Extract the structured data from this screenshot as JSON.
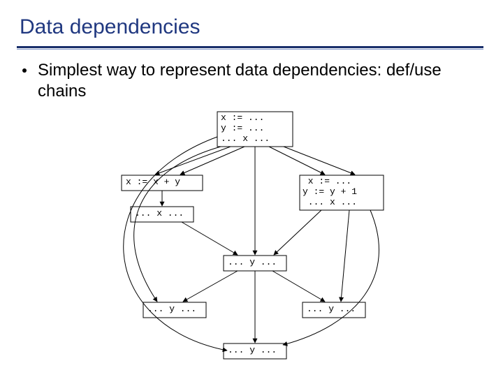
{
  "title": "Data dependencies",
  "bullet": "Simplest way to represent data dependencies: def/use chains",
  "nodes": {
    "top": "x := ...\ny := ...\n... x ...",
    "midL_a": "x := x + y",
    "midL_b": "... x ...",
    "midR": " x := ...\ny := y + 1\n ... x ...",
    "c": "... y ...",
    "botL": "... y ...",
    "botR": "... y ...",
    "bot": "... y ..."
  }
}
